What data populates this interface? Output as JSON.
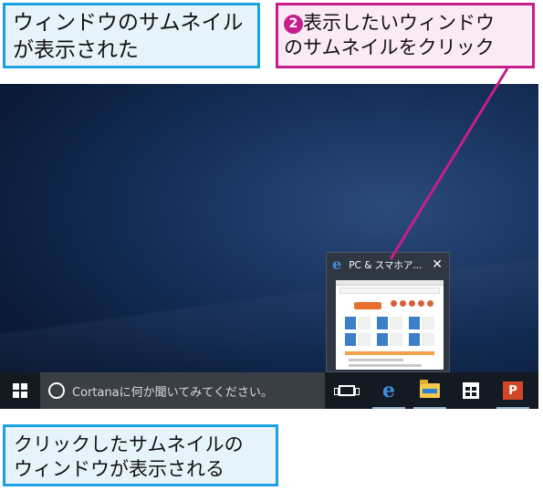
{
  "callouts": {
    "top_left": {
      "line1": "ウィンドウのサムネイル",
      "line2": "が表示された"
    },
    "top_right": {
      "step_number": "❷",
      "line1": "表示したいウィンドウ",
      "line2": "のサムネイルをクリック"
    },
    "bottom": {
      "line1": "クリックしたサムネイルの",
      "line2": "ウィンドウが表示される"
    }
  },
  "taskbar": {
    "search_placeholder": "Cortanaに何か聞いてみてください。",
    "pinned_apps": [
      "task-view",
      "edge",
      "file-explorer",
      "store",
      "powerpoint"
    ],
    "ppt_letter": "P"
  },
  "thumbnail_popup": {
    "title": "PC & スマホア...",
    "close_glyph": "✕",
    "edge_glyph": "e"
  },
  "colors": {
    "callout_blue": "#1ba1e2",
    "callout_pink": "#c81d8c",
    "taskbar": "#141a22",
    "search_box": "#3a3f45",
    "edge_blue": "#3a8fe0"
  }
}
